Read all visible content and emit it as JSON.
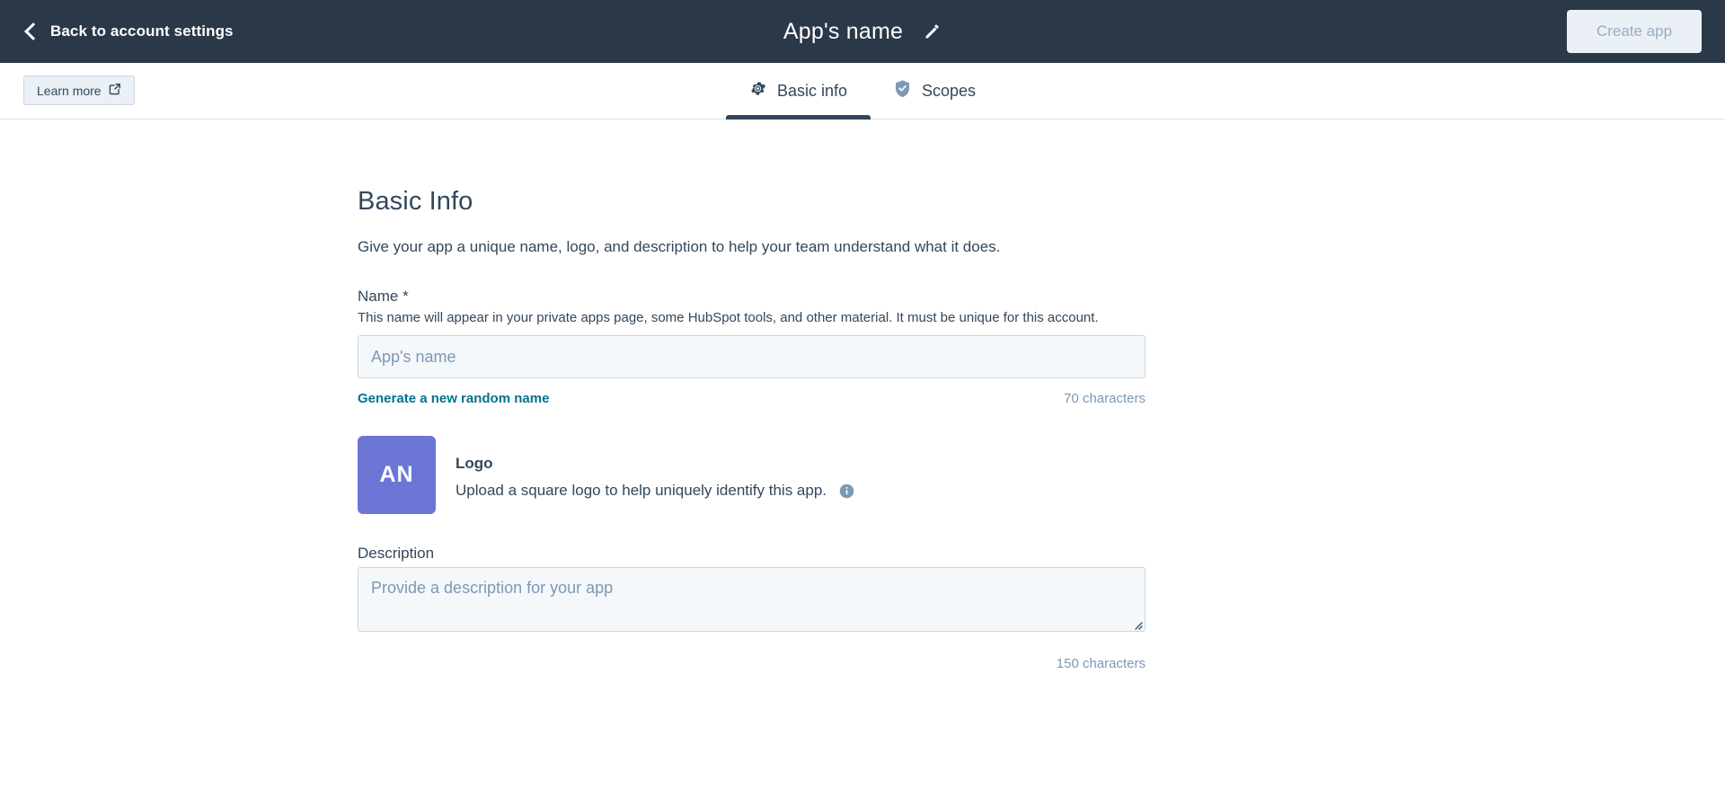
{
  "header": {
    "back_label": "Back to account settings",
    "back_icon": "chevron-left-icon",
    "title": "App's name",
    "edit_icon": "pencil-icon",
    "create_button": "Create app",
    "background_color": "#2a3847"
  },
  "tabbar": {
    "learn_more_label": "Learn more",
    "learn_more_icon": "external-link-icon",
    "tabs": [
      {
        "label": "Basic info",
        "icon": "gear-icon",
        "active": true
      },
      {
        "label": "Scopes",
        "icon": "shield-check-icon",
        "active": false
      }
    ],
    "active_underline_color": "#33475b"
  },
  "main": {
    "section_title": "Basic Info",
    "section_subtitle": "Give your app a unique name, logo, and description to help your team understand what it does.",
    "name_field": {
      "label": "Name *",
      "help": "This name will appear in your private apps page, some HubSpot tools, and other material. It must be unique for this account.",
      "value": "",
      "placeholder": "App's name",
      "generate_link": "Generate a new random name",
      "char_count": "70 characters",
      "link_color": "#00738f"
    },
    "logo": {
      "initials": "AN",
      "avatar_color": "#6a75d6",
      "title": "Logo",
      "description": "Upload a square logo to help uniquely identify this app.",
      "info_icon": "info-circle-icon"
    },
    "description_field": {
      "label": "Description",
      "value": "",
      "placeholder": "Provide a description for your app",
      "char_count": "150 characters"
    }
  }
}
